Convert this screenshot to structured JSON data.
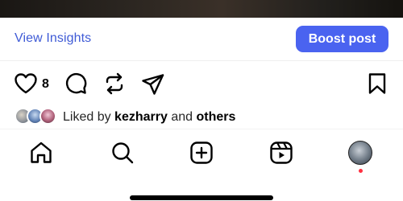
{
  "insights": {
    "view_label": "View Insights",
    "boost_label": "Boost post"
  },
  "actions": {
    "like_count": "8",
    "icons": [
      "heart-icon",
      "comment-icon",
      "repost-icon",
      "share-icon",
      "bookmark-icon"
    ]
  },
  "liked_by": {
    "prefix": "Liked by ",
    "user": "kezharry",
    "middle": " and ",
    "others": "others"
  },
  "tab_bar": {
    "icons": [
      "home-icon",
      "search-icon",
      "create-icon",
      "reels-icon",
      "profile-avatar"
    ]
  },
  "colors": {
    "link": "#3f5bd6",
    "button_bg": "#4a63f0",
    "notification_dot": "#ff3040"
  }
}
